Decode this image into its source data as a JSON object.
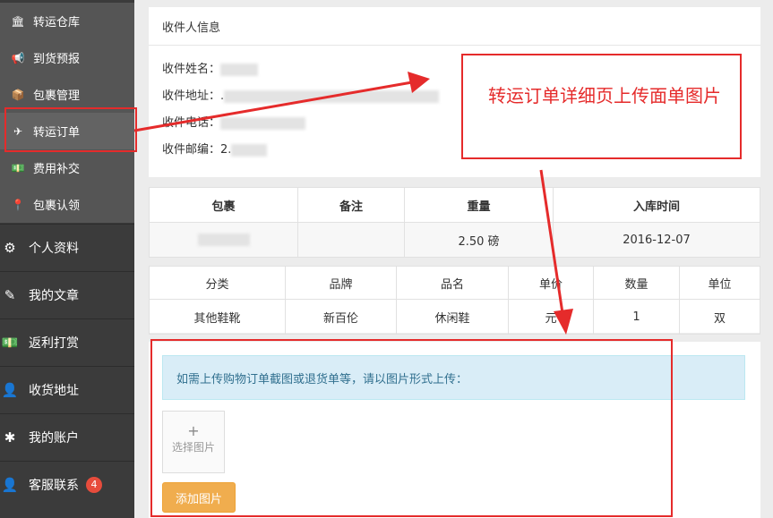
{
  "sidebar": {
    "sub_items": [
      {
        "label": "转运仓库",
        "icon": "bank-icon",
        "glyph": "🏛"
      },
      {
        "label": "到货预报",
        "icon": "bullhorn-icon",
        "glyph": "📢"
      },
      {
        "label": "包裹管理",
        "icon": "cube-icon",
        "glyph": "📦"
      },
      {
        "label": "转运订单",
        "icon": "plane-icon",
        "glyph": "✈"
      },
      {
        "label": "费用补交",
        "icon": "money-icon",
        "glyph": "💵"
      },
      {
        "label": "包裹认领",
        "icon": "map-marker-icon",
        "glyph": "📍"
      }
    ],
    "main_items": [
      {
        "label": "个人资料",
        "icon": "gear-icon",
        "glyph": "⚙"
      },
      {
        "label": "我的文章",
        "icon": "edit-icon",
        "glyph": "✎"
      },
      {
        "label": "返利打赏",
        "icon": "money-icon",
        "glyph": "💵"
      },
      {
        "label": "收货地址",
        "icon": "address-card-icon",
        "glyph": "👤"
      },
      {
        "label": "我的账户",
        "icon": "asterisk-icon",
        "glyph": "✱"
      },
      {
        "label": "客服联系",
        "icon": "user-icon",
        "glyph": "👤",
        "badge": "4"
      }
    ]
  },
  "recipient": {
    "title": "收件人信息",
    "name_label": "收件姓名：",
    "address_label": "收件地址：",
    "address_prefix": ".",
    "phone_label": "收件电话：",
    "zip_label": "收件邮编：",
    "zip_prefix": "2."
  },
  "package_table": {
    "headers": [
      "包裹",
      "备注",
      "重量",
      "入库时间"
    ],
    "row": {
      "weight": "2.50 磅",
      "date": "2016-12-07"
    }
  },
  "goods_table": {
    "headers": [
      "分类",
      "品牌",
      "品名",
      "单价",
      "数量",
      "单位"
    ],
    "row": [
      "其他鞋靴",
      "新百伦",
      "休闲鞋",
      "元",
      "1",
      "双"
    ]
  },
  "upload": {
    "notice": "如需上传购物订单截图或退货单等，请以图片形式上传：",
    "plus": "+",
    "select_label": "选择图片",
    "add_button": "添加图片"
  },
  "annotation": {
    "text": "转运订单详细页上传面单图片",
    "color": "#e52b2b"
  }
}
